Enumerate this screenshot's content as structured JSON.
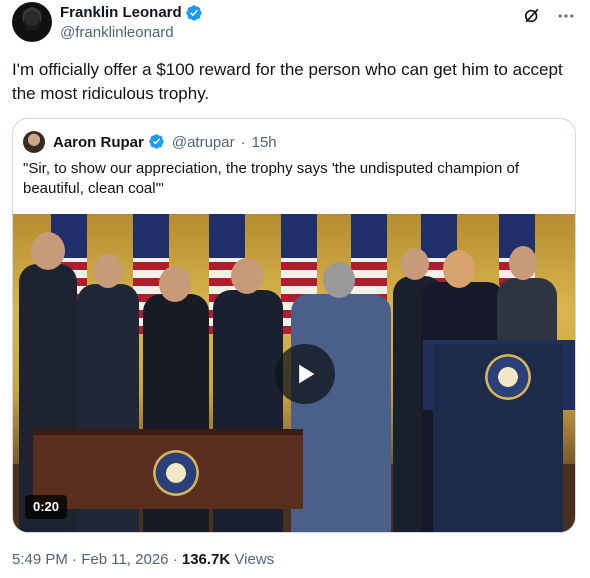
{
  "author": {
    "display_name": "Franklin Leonard",
    "handle": "@franklinleonard",
    "verified_icon": "verified-badge-icon"
  },
  "actions": {
    "grok_icon": "grok-icon",
    "more_icon": "more-icon"
  },
  "tweet": {
    "text": "I'm officially offer a $100 reward for the person who can get him to accept the most ridiculous trophy."
  },
  "quote": {
    "display_name": "Aaron Rupar",
    "handle": "@atrupar",
    "separator": "·",
    "age": "15h",
    "text": "\"Sir, to show our appreciation, the trophy says 'the undisputed champion of beautiful, clean coal'\"",
    "video": {
      "duration": "0:20",
      "play_icon": "play-icon"
    }
  },
  "meta": {
    "time": "5:49 PM",
    "sep1": "·",
    "date": "Feb 11, 2026",
    "sep2": "·",
    "views_count": "136.7K",
    "views_label": "Views"
  },
  "colors": {
    "text": "#0f1419",
    "muted": "#536471",
    "verified": "#1d9bf0",
    "border": "#cfd9de"
  }
}
